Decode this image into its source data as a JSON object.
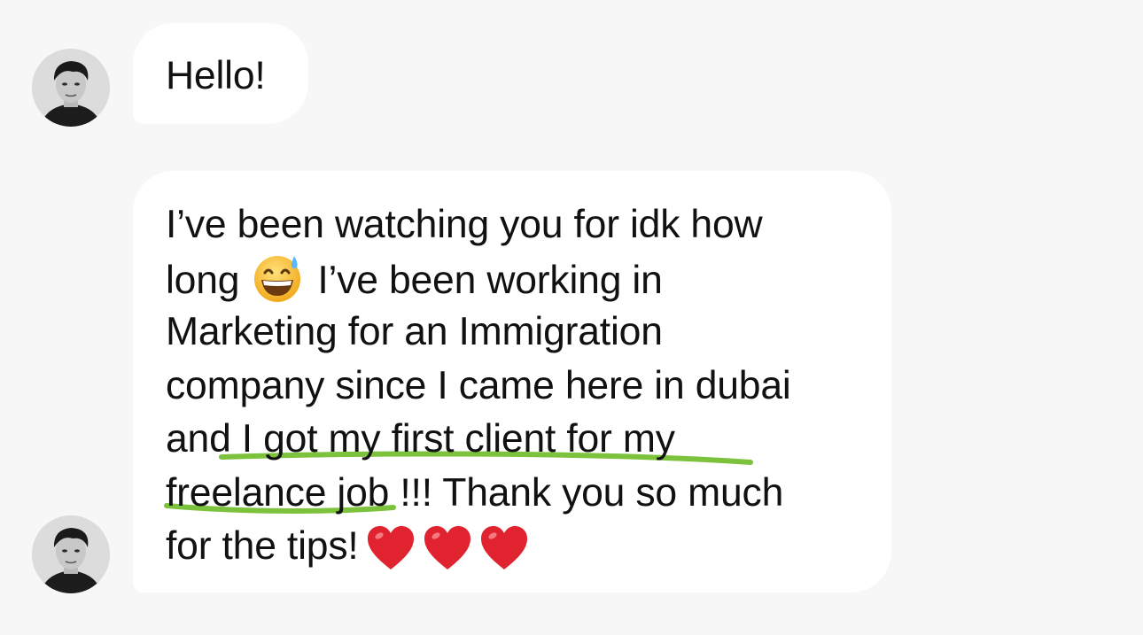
{
  "conversation": {
    "messages": [
      {
        "sender_avatar": "avatar",
        "lines": [
          "Hello!"
        ]
      },
      {
        "sender_avatar": "avatar",
        "lines": [
          "I’ve been watching you for idk how",
          "long",
          "I’ve been working in",
          "Marketing for an Immigration",
          "company since I came here in dubai",
          "and I got my first client for my",
          "freelance job !!! Thank you so much",
          "for the tips!"
        ],
        "inline_emoji": "grinning-face-with-sweat-icon",
        "trailing_emoji": [
          "red-heart-icon",
          "red-heart-icon",
          "red-heart-icon"
        ],
        "highlighted_phrase": "I got my first client for my freelance job",
        "highlight_color": "#7cc23c"
      }
    ]
  },
  "colors": {
    "background": "#f7f7f7",
    "bubble": "#ffffff",
    "text": "#111111",
    "highlight": "#7cc23c",
    "heart": "#e0232e"
  }
}
